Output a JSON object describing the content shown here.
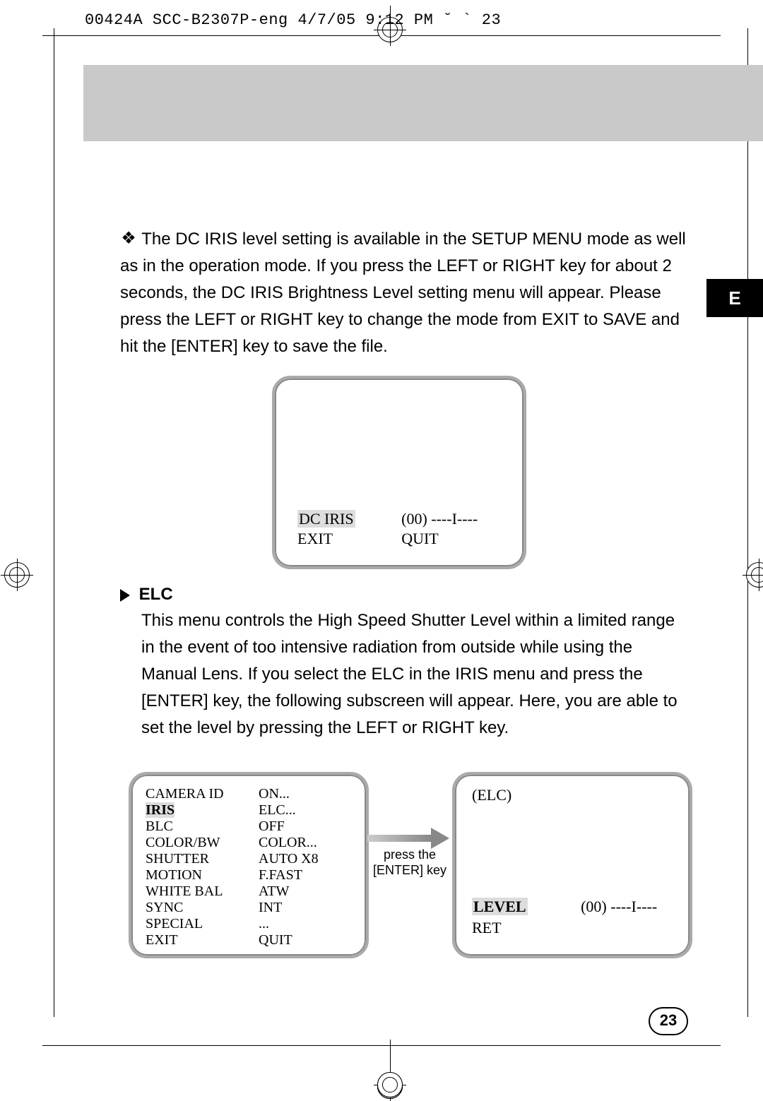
{
  "header_print_line": "00424A SCC-B2307P-eng  4/7/05 9:12 PM  ˘   `   23",
  "side_tab": "E",
  "paragraph1": "The DC IRIS level setting is available in the SETUP MENU mode as well as in the operation mode. If you press the LEFT or RIGHT key for about 2 seconds, the DC IRIS Brightness Level setting menu will appear. Please press the LEFT or RIGHT key to change the mode from EXIT to SAVE and hit the [ENTER] key to save the file.",
  "screen1": {
    "row1_left": "DC IRIS",
    "row1_right": "(00) ----I----",
    "row2_left": "EXIT",
    "row2_right": "QUIT"
  },
  "elc_heading": "ELC",
  "paragraph2": "This menu controls the High Speed Shutter Level within a limited range in the event of too intensive radiation from outside while using the Manual Lens. If you select the ELC in the IRIS menu and press the [ENTER] key, the following subscreen will appear. Here, you are able to set the level by pressing the LEFT or RIGHT key.",
  "menu": {
    "items": [
      {
        "k": "CAMERA ID",
        "v": "ON..."
      },
      {
        "k": "IRIS",
        "v": "ELC...",
        "hl": true
      },
      {
        "k": "BLC",
        "v": "OFF"
      },
      {
        "k": "COLOR/BW",
        "v": "COLOR..."
      },
      {
        "k": "SHUTTER",
        "v": "AUTO X8"
      },
      {
        "k": "MOTION",
        "v": "F.FAST"
      },
      {
        "k": "WHITE BAL",
        "v": "ATW"
      },
      {
        "k": "SYNC",
        "v": "INT"
      },
      {
        "k": "SPECIAL",
        "v": "..."
      },
      {
        "k": "EXIT",
        "v": "QUIT"
      }
    ]
  },
  "arrow_label_line1": "press the",
  "arrow_label_line2": "[ENTER] key",
  "screen3": {
    "title": "(ELC)",
    "row1_left": "LEVEL",
    "row1_right": "(00) ----I----",
    "row2_left": "RET"
  },
  "page_number": "23"
}
